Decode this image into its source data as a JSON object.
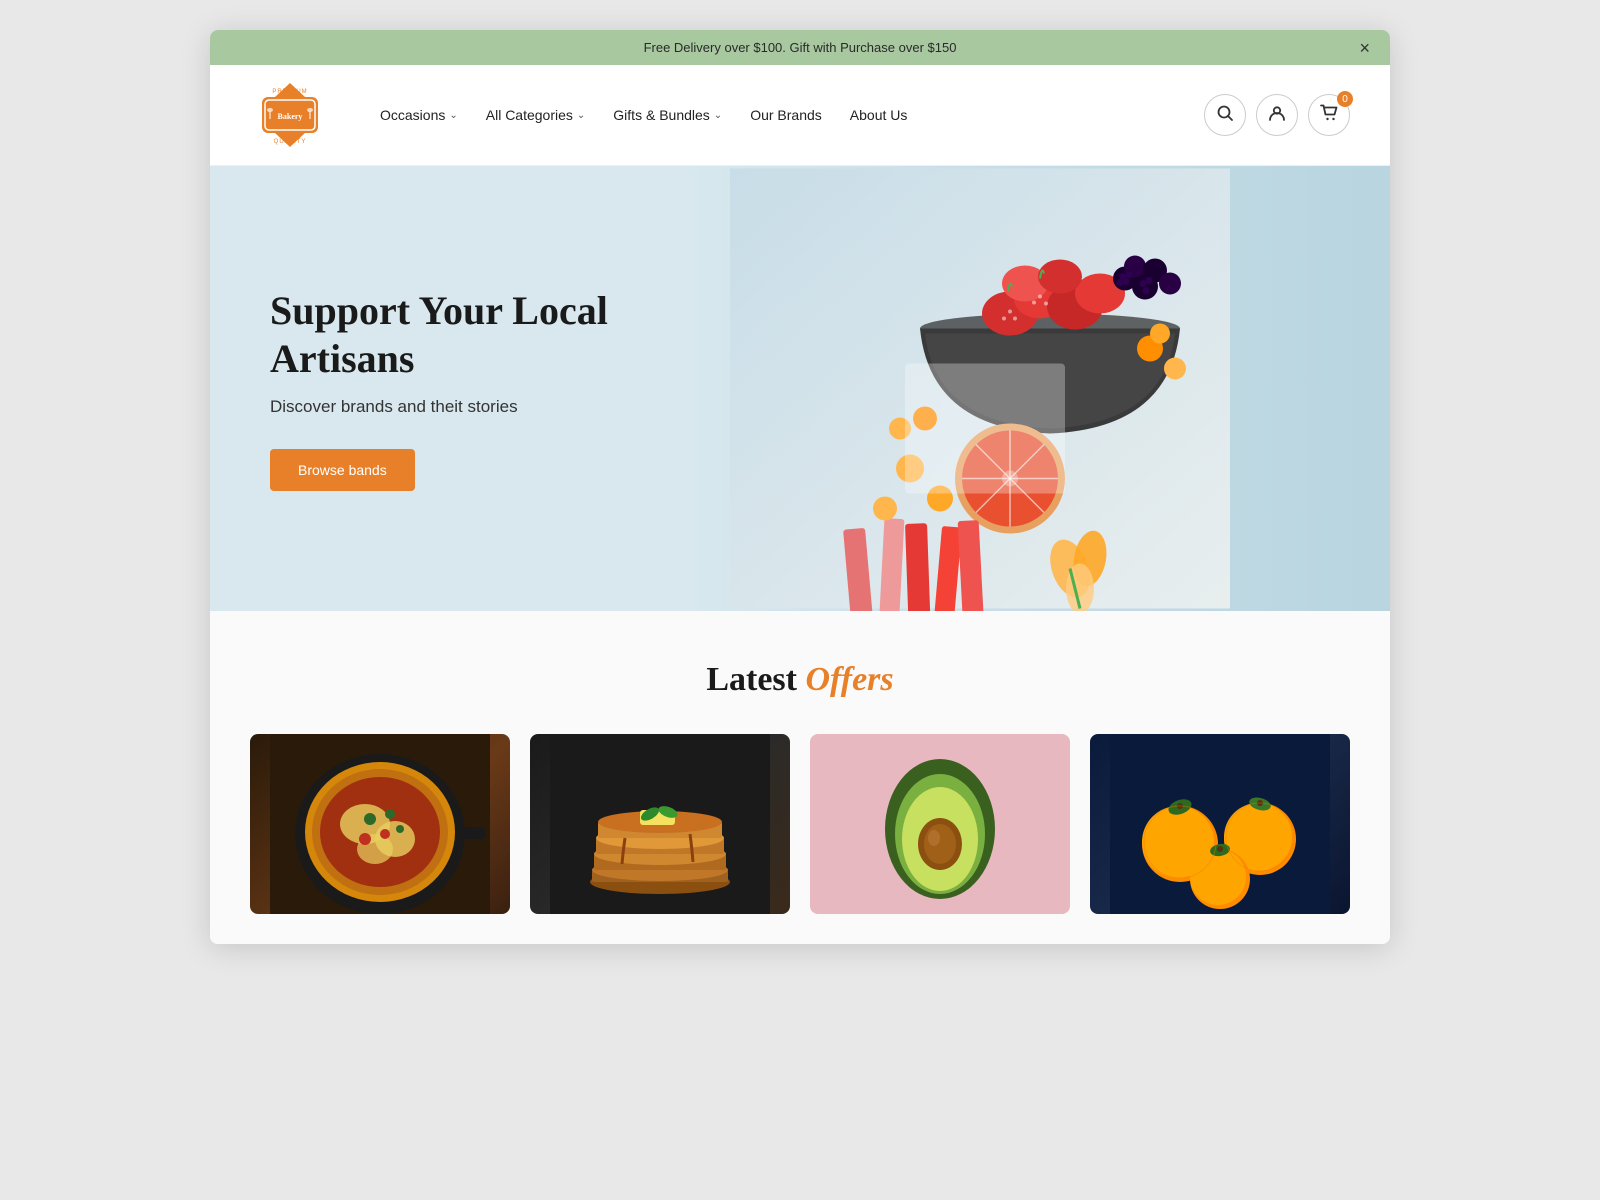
{
  "announcement": {
    "text": "Free Delivery over $100. Gift with Purchase over $150",
    "close_label": "×"
  },
  "header": {
    "logo_text": "PREMIUM\nBakery\nQUALITY",
    "nav": [
      {
        "label": "Occasions",
        "has_dropdown": true
      },
      {
        "label": "All Categories",
        "has_dropdown": true
      },
      {
        "label": "Gifts & Bundles",
        "has_dropdown": true
      },
      {
        "label": "Our Brands",
        "has_dropdown": false
      },
      {
        "label": "About Us",
        "has_dropdown": false
      }
    ],
    "cart_count": "0"
  },
  "hero": {
    "title": "Support Your Local Artisans",
    "subtitle": "Discover brands and theit stories",
    "cta_label": "Browse bands"
  },
  "latest_offers": {
    "title_plain": "Latest ",
    "title_accent": "Offers",
    "cards": [
      {
        "label": "Pizza",
        "bg_type": "pizza"
      },
      {
        "label": "Pancakes",
        "bg_type": "pancakes"
      },
      {
        "label": "Avocado",
        "bg_type": "avocado"
      },
      {
        "label": "Oranges",
        "bg_type": "oranges"
      }
    ]
  },
  "icons": {
    "search": "🔍",
    "user": "👤",
    "cart": "🛒",
    "chevron": "∨",
    "close": "×"
  }
}
